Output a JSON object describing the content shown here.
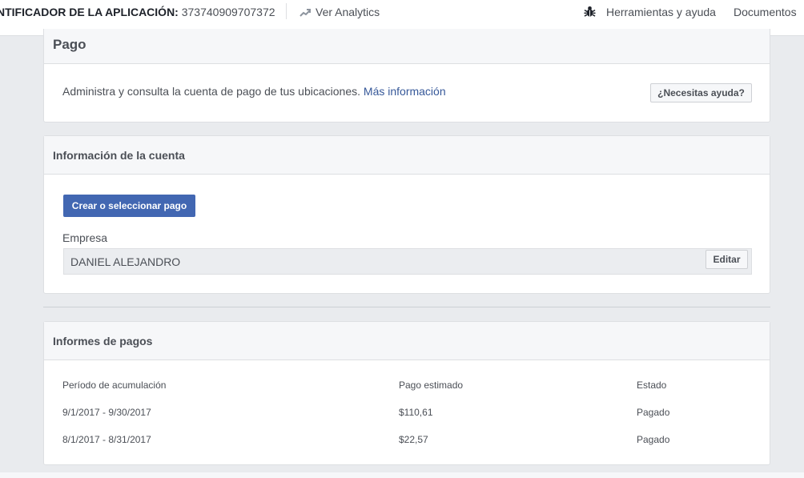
{
  "topbar": {
    "app_id_label": "NTIFICADOR DE LA APLICACIÓN:",
    "app_id_value": "373740909707372",
    "analytics": "Ver Analytics",
    "tools": "Herramientas y ayuda",
    "docs": "Documentos"
  },
  "payout": {
    "title": "Pago",
    "description": "Administra y consulta la cuenta de pago de tus ubicaciones.",
    "more_info": "Más información",
    "help_button": "¿Necesitas ayuda?"
  },
  "account": {
    "title": "Información de la cuenta",
    "create_button": "Crear o seleccionar pago",
    "company_label": "Empresa",
    "company_value": "DANIEL ALEJANDRO",
    "edit_button": "Editar"
  },
  "reports": {
    "title": "Informes de pagos",
    "headers": [
      "Período de acumulación",
      "Pago estimado",
      "Estado"
    ],
    "rows": [
      [
        "9/1/2017 - 9/30/2017",
        "$110,61",
        "Pagado"
      ],
      [
        "8/1/2017 - 8/31/2017",
        "$22,57",
        "Pagado"
      ]
    ]
  }
}
